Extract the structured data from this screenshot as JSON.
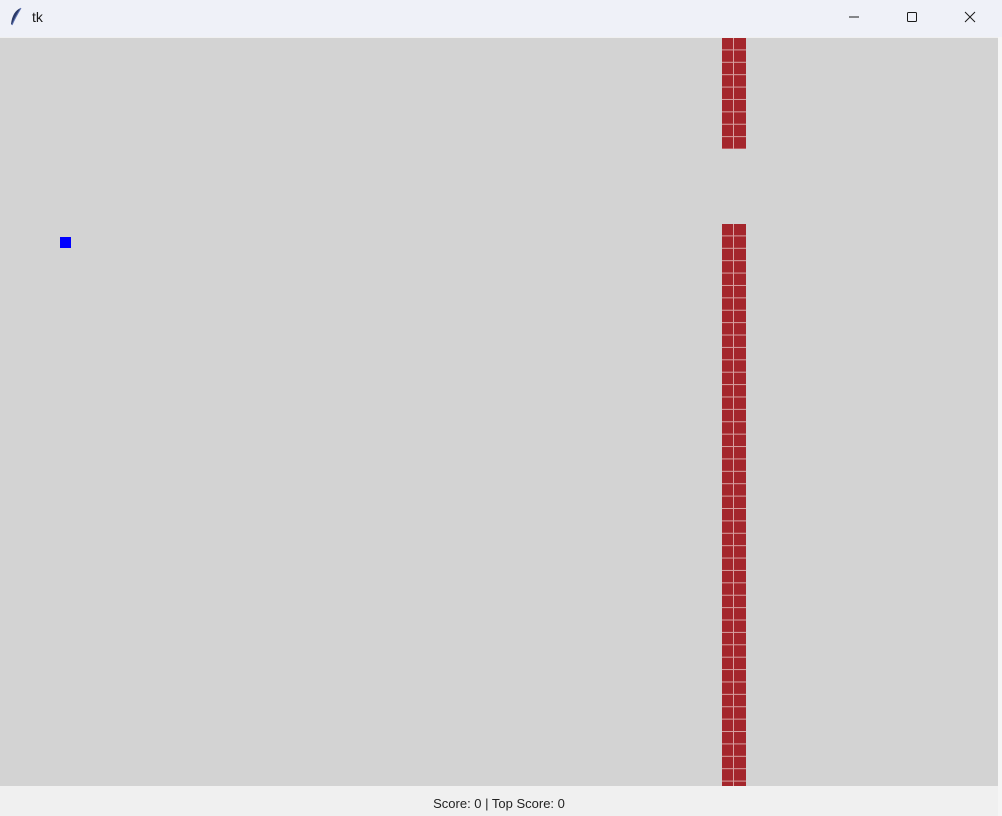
{
  "window": {
    "title": "tk",
    "controls": [
      "minimize-icon",
      "maximize-icon",
      "close-icon"
    ]
  },
  "game": {
    "player_color": "#0000ff",
    "pipe_color": "#a4262c",
    "background_color": "#d3d3d3"
  },
  "status": {
    "score_text": "Score: 0 | Top Score: 0"
  }
}
